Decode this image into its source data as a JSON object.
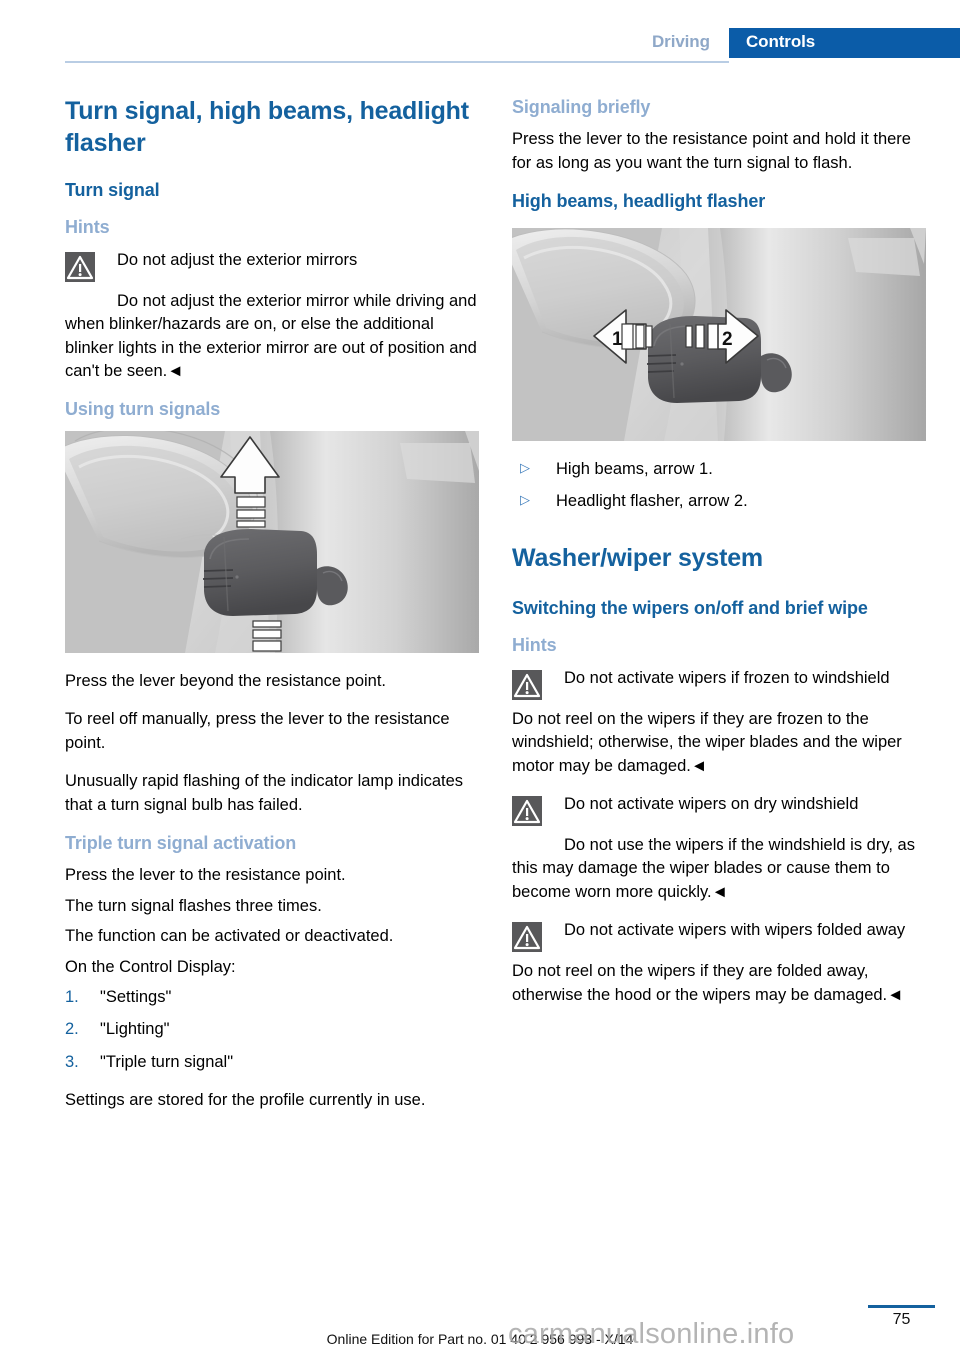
{
  "header": {
    "chapter": "Driving",
    "section": "Controls"
  },
  "left_column": {
    "title": "Turn signal, high beams, headlight flasher",
    "turn_signal_heading": "Turn signal",
    "hints_heading": "Hints",
    "warning_mirrors": {
      "icon": "warning-triangle-icon",
      "title": "Do not adjust the exterior mirrors",
      "body": "Do not adjust the exterior mirror while driving and when blinker/hazards are on, or else the additional blinker lights in the exterior mirror are out of position and can't be seen.◄"
    },
    "using_turn_signals_heading": "Using turn signals",
    "figure_turn_signal": {
      "alt": "Turn signal lever with up and down arrows",
      "arrow_up": "up-arrow",
      "arrow_down": "down-arrow"
    },
    "paragraphs": [
      "Press the lever beyond the resistance point.",
      "To reel off manually, press the lever to the resistance point.",
      "Unusually rapid flashing of the indicator lamp indicates that a turn signal bulb has failed."
    ],
    "triple_turn_heading": "Triple turn signal activation",
    "triple_paragraphs": [
      "Press the lever to the resistance point.",
      "The turn signal flashes three times.",
      "The function can be activated or deactivated.",
      "On the Control Display:"
    ],
    "steps": [
      {
        "num": "1.",
        "text": "\"Settings\""
      },
      {
        "num": "2.",
        "text": "\"Lighting\""
      },
      {
        "num": "3.",
        "text": "\"Triple turn signal\""
      }
    ],
    "closing_paragraph": "Settings are stored for the profile currently in use."
  },
  "right_column": {
    "signaling_briefly_heading": "Signaling briefly",
    "signaling_briefly_body": "Press the lever to the resistance point and hold it there for as long as you want the turn signal to flash.",
    "high_beams_heading": "High beams, headlight flasher",
    "figure_high_beams": {
      "alt": "Turn signal lever with left and right arrows",
      "label_left": "1",
      "label_right": "2"
    },
    "bullets": [
      {
        "marker": "▷",
        "text": "High beams, arrow 1."
      },
      {
        "marker": "▷",
        "text": "Headlight flasher, arrow 2."
      }
    ],
    "washer_wiper_title": "Washer/wiper system",
    "switching_heading": "Switching the wipers on/off and brief wipe",
    "hints_heading": "Hints",
    "warning_frozen": {
      "icon": "warning-triangle-icon",
      "title": "Do not activate wipers if frozen to windshield",
      "body": "Do not reel on the wipers if they are frozen to the windshield; otherwise, the wiper blades and the wiper motor may be damaged.◄"
    },
    "warning_dry": {
      "icon": "warning-triangle-icon",
      "title": "Do not activate wipers on dry windshield",
      "body_lead": "Do not use the wipers if the windshield is",
      "body_rest": "dry, as this may damage the wiper blades or cause them to become worn more quickly.◄"
    },
    "warning_folded": {
      "icon": "warning-triangle-icon",
      "title": "Do not activate wipers with wipers folded away",
      "body": "Do not reel on the wipers if they are folded away, otherwise the hood or the wipers may be damaged.◄"
    }
  },
  "footer": {
    "edition_note": "Online Edition for Part no. 01 40 2 956 993 - X/14",
    "page_number": "75",
    "watermark": "carmanualsonline.info"
  },
  "colors": {
    "heading_blue": "#14619e",
    "light_blue": "#8fadd1",
    "band_blue": "#0b5ca8",
    "rule_blue": "#b9cde4",
    "warn_gray": "#58585a"
  }
}
